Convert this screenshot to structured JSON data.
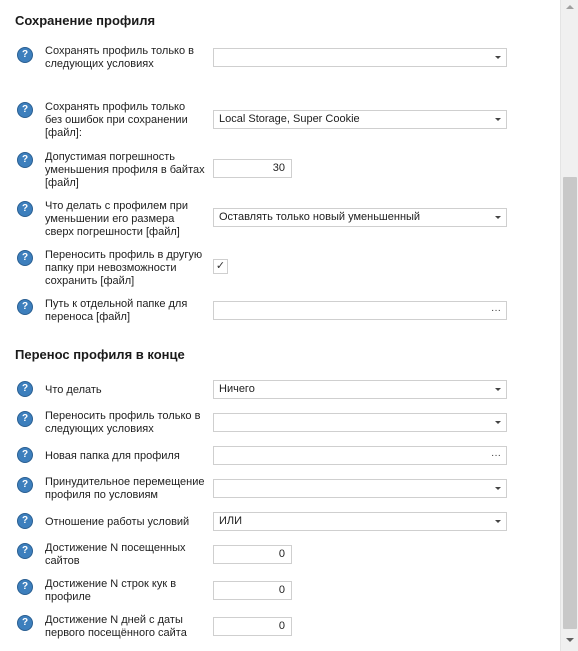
{
  "sections": {
    "save_title": "Сохранение профиля",
    "transfer_title": "Перенос профиля в конце"
  },
  "rows": {
    "save_conditions": {
      "label": "Сохранять профиль только в следующих условиях",
      "value": ""
    },
    "save_no_errors": {
      "label": "Сохранять профиль только без ошибок при сохранении [файл]:",
      "value": "Local Storage, Super Cookie"
    },
    "tolerance": {
      "label": "Допустимая погрешность уменьшения профиля в байтах [файл]",
      "value": "30"
    },
    "on_shrink": {
      "label": "Что делать с профилем при уменьшении его размера сверх погрешности [файл]",
      "value": "Оставлять только новый уменьшенный"
    },
    "move_on_fail": {
      "label": "Переносить профиль в другую папку при невозможности сохранить [файл]",
      "checked": "✓"
    },
    "move_path": {
      "label": "Путь к отдельной папке для переноса [файл]",
      "value": "",
      "button": "···"
    },
    "what_to_do": {
      "label": "Что делать",
      "value": "Ничего"
    },
    "transfer_conditions": {
      "label": "Переносить профиль только в следующих условиях",
      "value": ""
    },
    "new_folder": {
      "label": "Новая папка для профиля",
      "value": "",
      "button": "···"
    },
    "forced_move": {
      "label": "Принудительное перемещение профиля по условиям",
      "value": ""
    },
    "conditions_relation": {
      "label": "Отношение работы условий",
      "value": "ИЛИ"
    },
    "sites_visited": {
      "label": "Достижение N посещенных сайтов",
      "value": "0"
    },
    "cookie_lines": {
      "label": "Достижение N строк кук в профиле",
      "value": "0"
    },
    "days_since_first": {
      "label": "Достижение N дней с даты первого посещённого сайта",
      "value": "0"
    }
  },
  "icons": {
    "help": "?"
  },
  "colors": {
    "help_icon": "#3d7fbd",
    "field_border": "#cfcfcf"
  }
}
